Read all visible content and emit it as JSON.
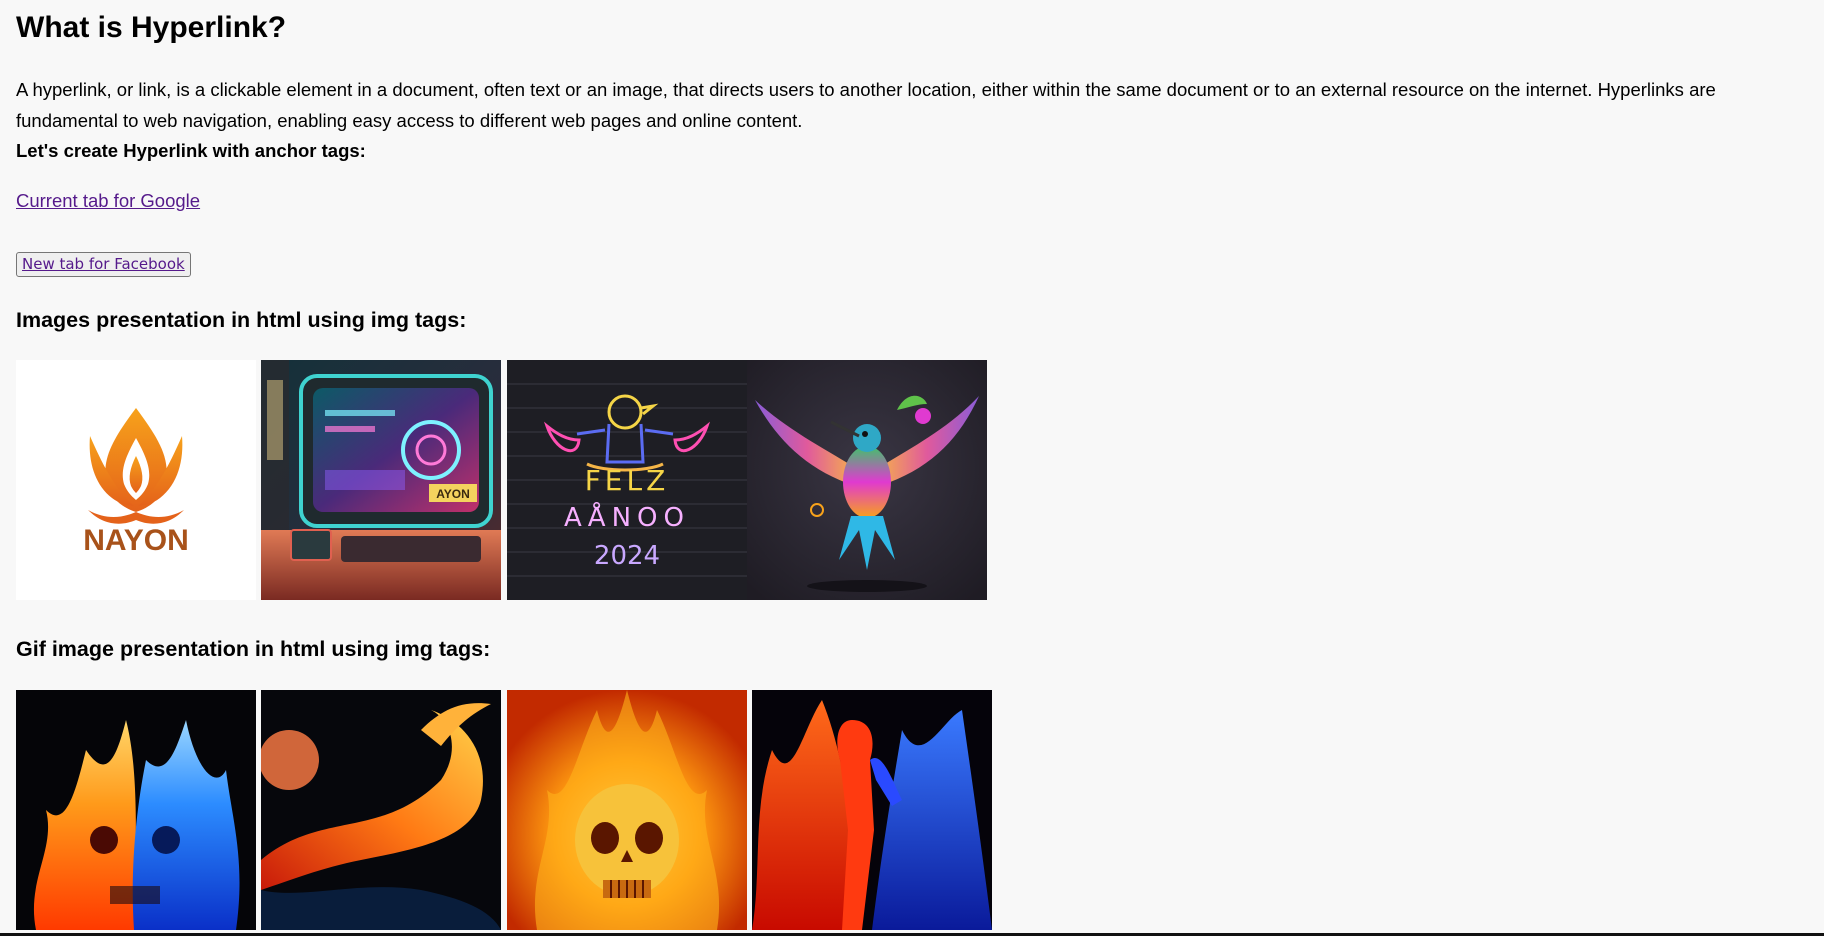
{
  "heading": "What is Hyperlink?",
  "intro": "A hyperlink, or link, is a clickable element in a document, often text or an image, that directs users to another location, either within the same document or to an external resource on the internet. Hyperlinks are fundamental to web navigation, enabling easy access to different web pages and online content.",
  "subheading": "Let's create Hyperlink with anchor tags:",
  "links": {
    "google": "Current tab for Google",
    "facebook": "New tab for Facebook"
  },
  "sections": {
    "images_title": "Images presentation in html using img tags:",
    "gifs_title": "Gif image presentation in html using img tags:"
  },
  "images": {
    "logo_text": "NAYON",
    "monitor_text": "AYON",
    "neon_line1": "FELZ",
    "neon_line2": "AÅNOO",
    "neon_line3": "2024"
  },
  "colors": {
    "link_visited": "#551a8b",
    "logo_orange": "#f08a1c",
    "logo_brown": "#a8521a"
  }
}
